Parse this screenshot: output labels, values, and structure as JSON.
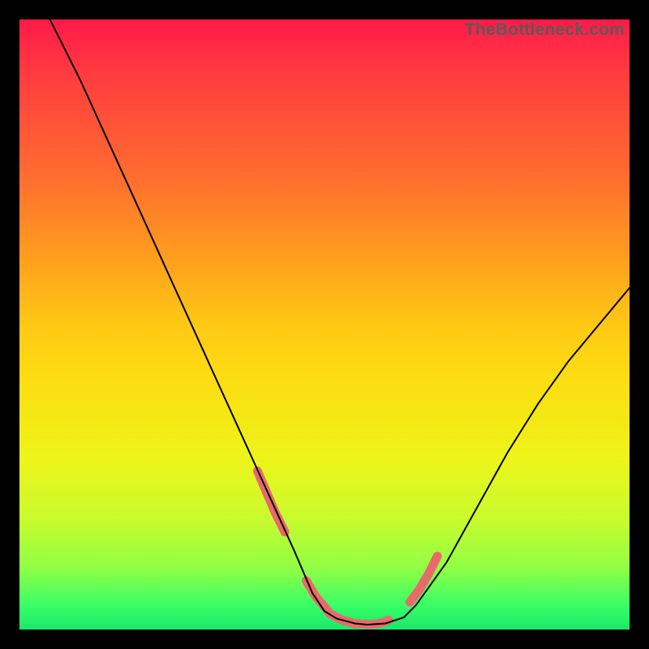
{
  "attribution": "TheBottleneck.com",
  "chart_data": {
    "type": "line",
    "title": "",
    "xlabel": "",
    "ylabel": "",
    "xlim": [
      0,
      100
    ],
    "ylim": [
      0,
      100
    ],
    "series": [
      {
        "name": "curve",
        "x": [
          5,
          10,
          15,
          20,
          25,
          30,
          35,
          40,
          45,
          48,
          50,
          52,
          55,
          57,
          60,
          63,
          65,
          70,
          75,
          80,
          85,
          90,
          95,
          100
        ],
        "values": [
          100,
          90,
          79,
          68,
          57,
          46,
          35,
          24,
          13,
          6,
          3,
          1.8,
          1,
          0.8,
          1,
          2,
          4,
          11,
          20,
          29,
          37,
          44,
          50,
          56
        ]
      }
    ],
    "markers": {
      "name": "highlight-dots",
      "color": "#e96a6a",
      "x": [
        39,
        40.5,
        42,
        43.5,
        47,
        48.5,
        51,
        53,
        55,
        57.5,
        59,
        60.5,
        64,
        65.5,
        67,
        68.5
      ],
      "values": [
        26,
        22.5,
        19,
        16,
        8,
        5.5,
        2.5,
        1.5,
        1,
        0.8,
        1,
        1.5,
        4.5,
        6.5,
        9,
        12
      ]
    }
  }
}
